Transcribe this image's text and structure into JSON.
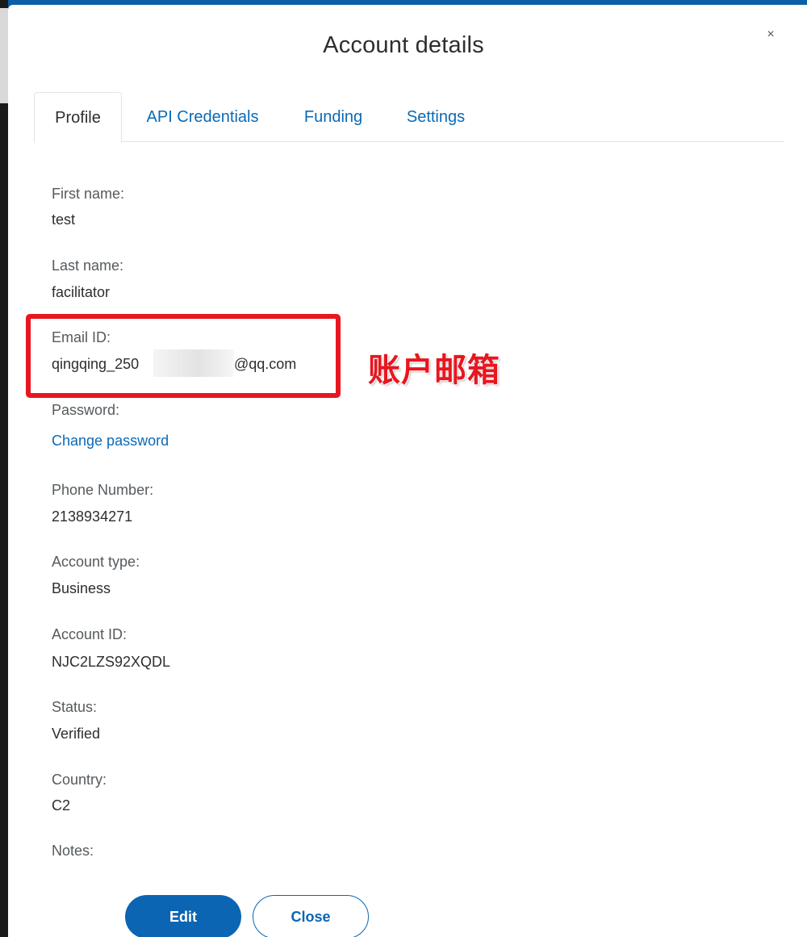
{
  "dialog": {
    "title": "Account details",
    "close_label": "×"
  },
  "tabs": [
    {
      "label": "Profile",
      "active": true
    },
    {
      "label": "API Credentials",
      "active": false
    },
    {
      "label": "Funding",
      "active": false
    },
    {
      "label": "Settings",
      "active": false
    }
  ],
  "profile": {
    "first_name": {
      "label": "First name:",
      "value": "test"
    },
    "last_name": {
      "label": "Last name:",
      "value": "facilitator"
    },
    "email": {
      "label": "Email ID:",
      "value_prefix": "qingqing_250",
      "value_suffix": "@qq.com"
    },
    "password": {
      "label": "Password:",
      "link": "Change password"
    },
    "phone": {
      "label": "Phone Number:",
      "value": "2138934271"
    },
    "account_type": {
      "label": "Account type:",
      "value": "Business"
    },
    "account_id": {
      "label": "Account ID:",
      "value": "NJC2LZS92XQDL"
    },
    "status": {
      "label": "Status:",
      "value": "Verified"
    },
    "country": {
      "label": "Country:",
      "value": "C2"
    },
    "notes": {
      "label": "Notes:"
    }
  },
  "annotation": {
    "text": "账户邮箱",
    "color": "#e8161f"
  },
  "buttons": {
    "edit_label": "Edit",
    "close_label": "Close"
  },
  "colors": {
    "link": "#0a6ab7",
    "primary_button": "#0b65b3",
    "header_strip": "#0b5ea8"
  }
}
